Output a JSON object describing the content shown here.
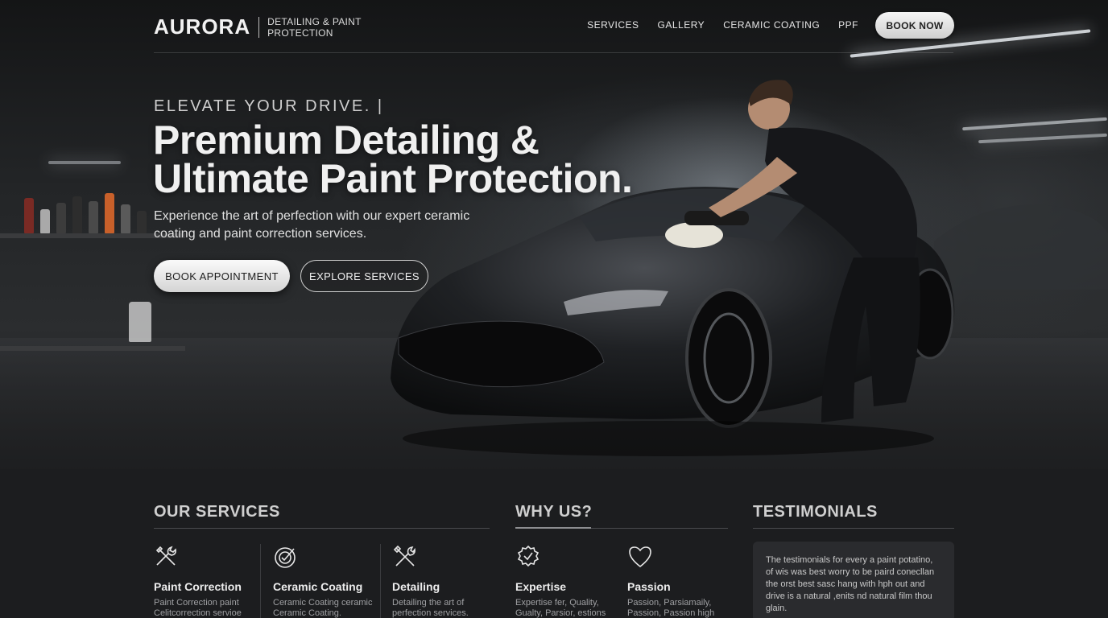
{
  "brand": {
    "logo": "AURORA",
    "tagline": "DETAILING & PAINT PROTECTION"
  },
  "nav": {
    "links": [
      "SERVICES",
      "GALLERY",
      "CERAMIC COATING",
      "PPF"
    ],
    "cta": "BOOK NOW"
  },
  "hero": {
    "eyebrow": "ELEVATE YOUR DRIVE. |",
    "headline_line1": "Premium Detailing &",
    "headline_line2": "Ultimate Paint Protection.",
    "subtext": "Experience the art of perfection with our expert ceramic coating and paint correction services.",
    "primary_button": "BOOK APPOINTMENT",
    "secondary_button": "EXPLORE SERVICES"
  },
  "services": {
    "title": "OUR SERVICES",
    "items": [
      {
        "icon": "wrench-screwdriver-icon",
        "title": "Paint Correction",
        "text": "Paint Correction paint Celitcorrection servioe"
      },
      {
        "icon": "target-check-icon",
        "title": "Ceramic Coating",
        "text": "Ceramic Coating ceramic Ceramic Coating."
      },
      {
        "icon": "crossed-tools-icon",
        "title": "Detailing",
        "text": "Detailing the art of perfection services."
      }
    ]
  },
  "why_us": {
    "title": "WHY US?",
    "items": [
      {
        "icon": "award-badge-icon",
        "title": "Expertise",
        "text": "Expertise fer, Quality, Gualty, Parsior, estions"
      },
      {
        "icon": "heart-icon",
        "title": "Passion",
        "text": "Passion, Parsiamaily, Passion, Passion high"
      }
    ]
  },
  "testimonials": {
    "title": "TESTIMONIALS",
    "text": "The testimonials for every a paint potatino, of wis was best worry to be paird conecllan the orst best sasc hang with hph out and drive is a natural ,enits nd natural film thou glain."
  },
  "colors": {
    "background": "#1c1d1f",
    "accent": "#f2f2f2",
    "muted": "#9fa0a3"
  }
}
